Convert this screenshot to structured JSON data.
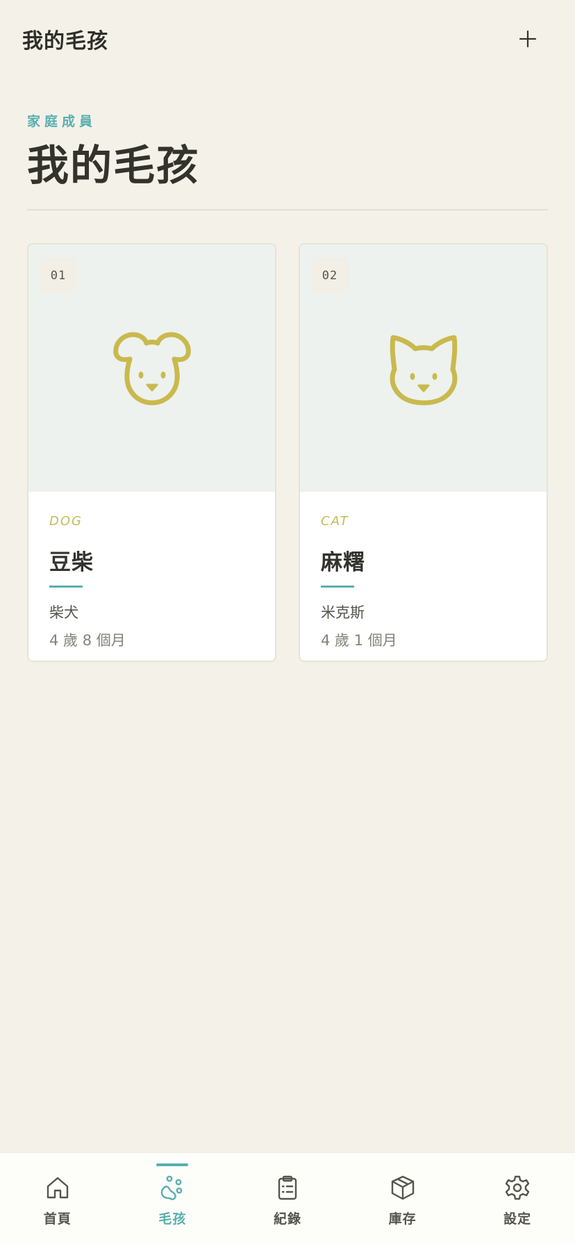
{
  "header": {
    "title": "我的毛孩",
    "add_icon": "plus-icon"
  },
  "section": {
    "eyebrow": "家庭成員",
    "title": "我的毛孩"
  },
  "pets": [
    {
      "number": "01",
      "species": "DOG",
      "name": "豆柴",
      "breed": "柴犬",
      "age": "4 歲 8 個月",
      "icon": "dog-face-icon"
    },
    {
      "number": "02",
      "species": "CAT",
      "name": "麻糬",
      "breed": "米克斯",
      "age": "4 歲 1 個月",
      "icon": "cat-face-icon"
    }
  ],
  "nav": {
    "items": [
      {
        "label": "首頁",
        "icon": "home-icon"
      },
      {
        "label": "毛孩",
        "icon": "paw-icon",
        "active": true
      },
      {
        "label": "紀錄",
        "icon": "clipboard-icon"
      },
      {
        "label": "庫存",
        "icon": "box-icon"
      },
      {
        "label": "設定",
        "icon": "gear-icon"
      }
    ]
  },
  "colors": {
    "background": "#f4f2e8",
    "accent": "#58aeb0",
    "species_label": "#c2bb58",
    "pet_icon": "#c9b94e",
    "card_media": "#edf2ee"
  }
}
